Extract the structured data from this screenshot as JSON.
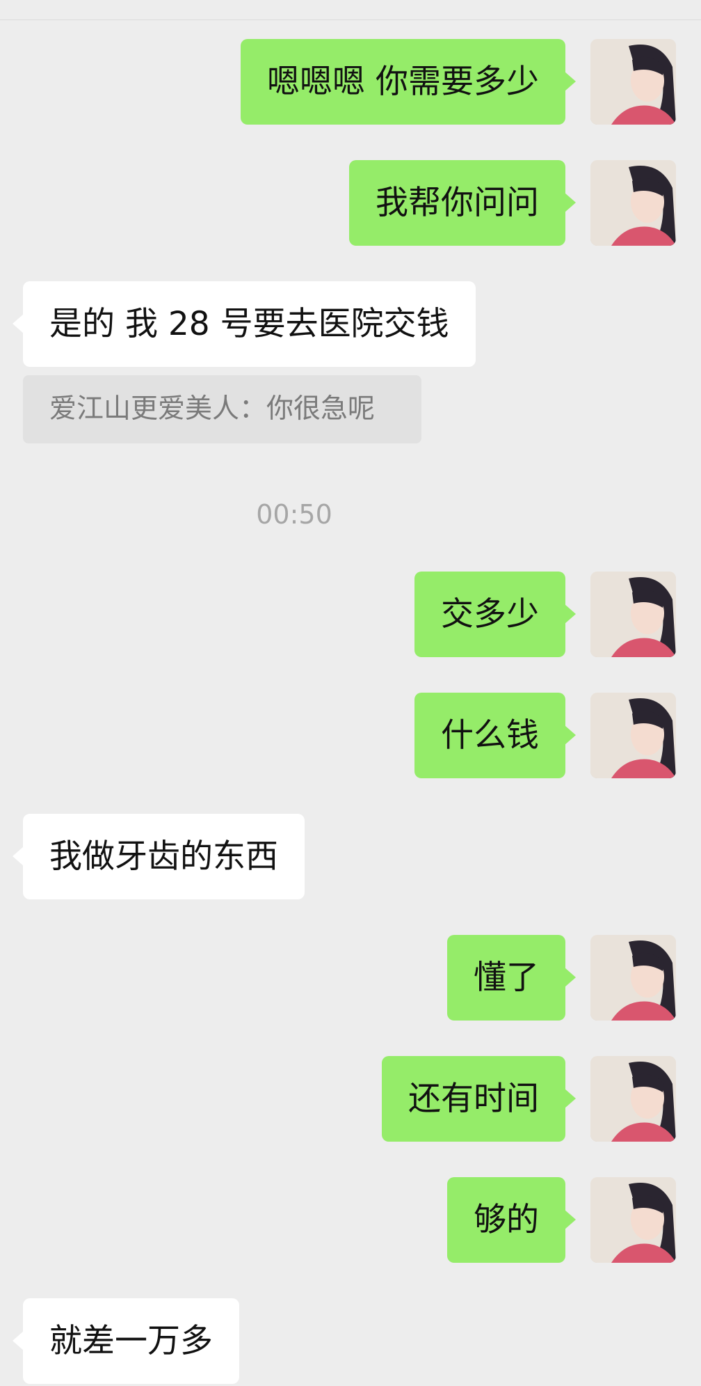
{
  "messages": [
    {
      "side": "me",
      "text": "嗯嗯嗯 你需要多少"
    },
    {
      "side": "me",
      "text": "我帮你问问"
    },
    {
      "side": "them",
      "text": "是的 我 28 号要去医院交钱"
    },
    {
      "side": "me",
      "text": "交多少"
    },
    {
      "side": "me",
      "text": "什么钱"
    },
    {
      "side": "them",
      "text": "我做牙齿的东西"
    },
    {
      "side": "me",
      "text": "懂了"
    },
    {
      "side": "me",
      "text": "还有时间"
    },
    {
      "side": "me",
      "text": "够的"
    },
    {
      "side": "them",
      "text": "就差一万多"
    }
  ],
  "quote_reply": "爱江山更爱美人：你很急呢",
  "timestamp": "00:50",
  "colors": {
    "my_bubble": "#95ec69",
    "their_bubble": "#ffffff",
    "background": "#ededed"
  },
  "icons": {
    "avatar": "user-avatar-photo"
  }
}
